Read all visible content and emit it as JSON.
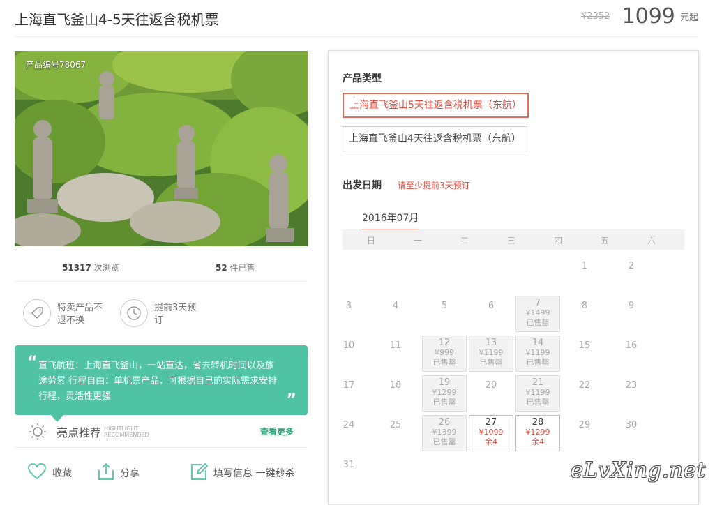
{
  "header": {
    "title": "上海直飞釜山4-5天往返含税机票",
    "old_price": "¥2352",
    "price": "1099",
    "price_unit": "元起"
  },
  "gallery": {
    "product_no": "产品编号78067"
  },
  "stats": {
    "views_count": "51317",
    "views_label": "次浏览",
    "sold_count": "52",
    "sold_label": "件已售"
  },
  "features": [
    {
      "icon": "tag-icon",
      "text": "特卖产品不退不换"
    },
    {
      "icon": "clock-icon",
      "text": "提前3天预订"
    }
  ],
  "quote": {
    "open": "“",
    "close": "”",
    "text": "直飞航班：上海直飞釜山，一站直达，省去转机时间以及旅途劳累 行程自由：单机票产品，可根据自己的实际需求安排行程，灵活性更强"
  },
  "highlight": {
    "title": "亮点推荐",
    "en_line1": "HIGHTLIGHT",
    "en_line2": "RECOMMENDED",
    "more": "查看更多"
  },
  "actions": {
    "favorite": "收藏",
    "share": "分享",
    "fill_info": "填写信息 一键秒杀"
  },
  "booking": {
    "type_label": "产品类型",
    "options": [
      {
        "label": "上海直飞釜山5天往返含税机票（东航）",
        "selected": true
      },
      {
        "label": "上海直飞釜山4天往返含税机票（东航）",
        "selected": false
      }
    ],
    "date_label": "出发日期",
    "notice": "请至少提前3天预订",
    "month": "2016年07月",
    "weekdays": [
      "日",
      "一",
      "二",
      "三",
      "四",
      "五",
      "六"
    ]
  },
  "calendar": {
    "weeks": [
      [
        {
          "day": ""
        },
        {
          "day": ""
        },
        {
          "day": ""
        },
        {
          "day": ""
        },
        {
          "day": ""
        },
        {
          "day": "1"
        },
        {
          "day": "2"
        }
      ],
      [
        {
          "day": "3"
        },
        {
          "day": "4"
        },
        {
          "day": "5"
        },
        {
          "day": "6"
        },
        {
          "day": "7",
          "state": "sold",
          "price": "¥1499",
          "note": "已售罄"
        },
        {
          "day": "8"
        },
        {
          "day": "9"
        }
      ],
      [
        {
          "day": "10"
        },
        {
          "day": "11"
        },
        {
          "day": "12",
          "state": "sold",
          "price": "¥999",
          "note": "已售罄"
        },
        {
          "day": "13",
          "state": "sold",
          "price": "¥1199",
          "note": "已售罄"
        },
        {
          "day": "14",
          "state": "sold",
          "price": "¥1199",
          "note": "已售罄"
        },
        {
          "day": "15"
        },
        {
          "day": "16"
        }
      ],
      [
        {
          "day": "17"
        },
        {
          "day": "18"
        },
        {
          "day": "19",
          "state": "sold",
          "price": "¥1299",
          "note": "已售罄"
        },
        {
          "day": "20"
        },
        {
          "day": "21",
          "state": "sold",
          "price": "¥1199",
          "note": "已售罄"
        },
        {
          "day": "22"
        },
        {
          "day": "23"
        }
      ],
      [
        {
          "day": "24"
        },
        {
          "day": "25"
        },
        {
          "day": "26",
          "state": "sold",
          "price": "¥1399",
          "note": "已售罄"
        },
        {
          "day": "27",
          "state": "avail",
          "price": "¥1099",
          "note": "余4"
        },
        {
          "day": "28",
          "state": "avail",
          "price": "¥1299",
          "note": "余4"
        },
        {
          "day": "29"
        },
        {
          "day": "30"
        }
      ],
      [
        {
          "day": "31"
        },
        {
          "day": ""
        },
        {
          "day": ""
        },
        {
          "day": ""
        },
        {
          "day": ""
        },
        {
          "day": ""
        },
        {
          "day": ""
        }
      ]
    ]
  },
  "watermark": "eLvXing.net",
  "colors": {
    "accent_red": "#e4473a",
    "teal": "#4fc3a4",
    "link_green": "#2aa67c"
  }
}
